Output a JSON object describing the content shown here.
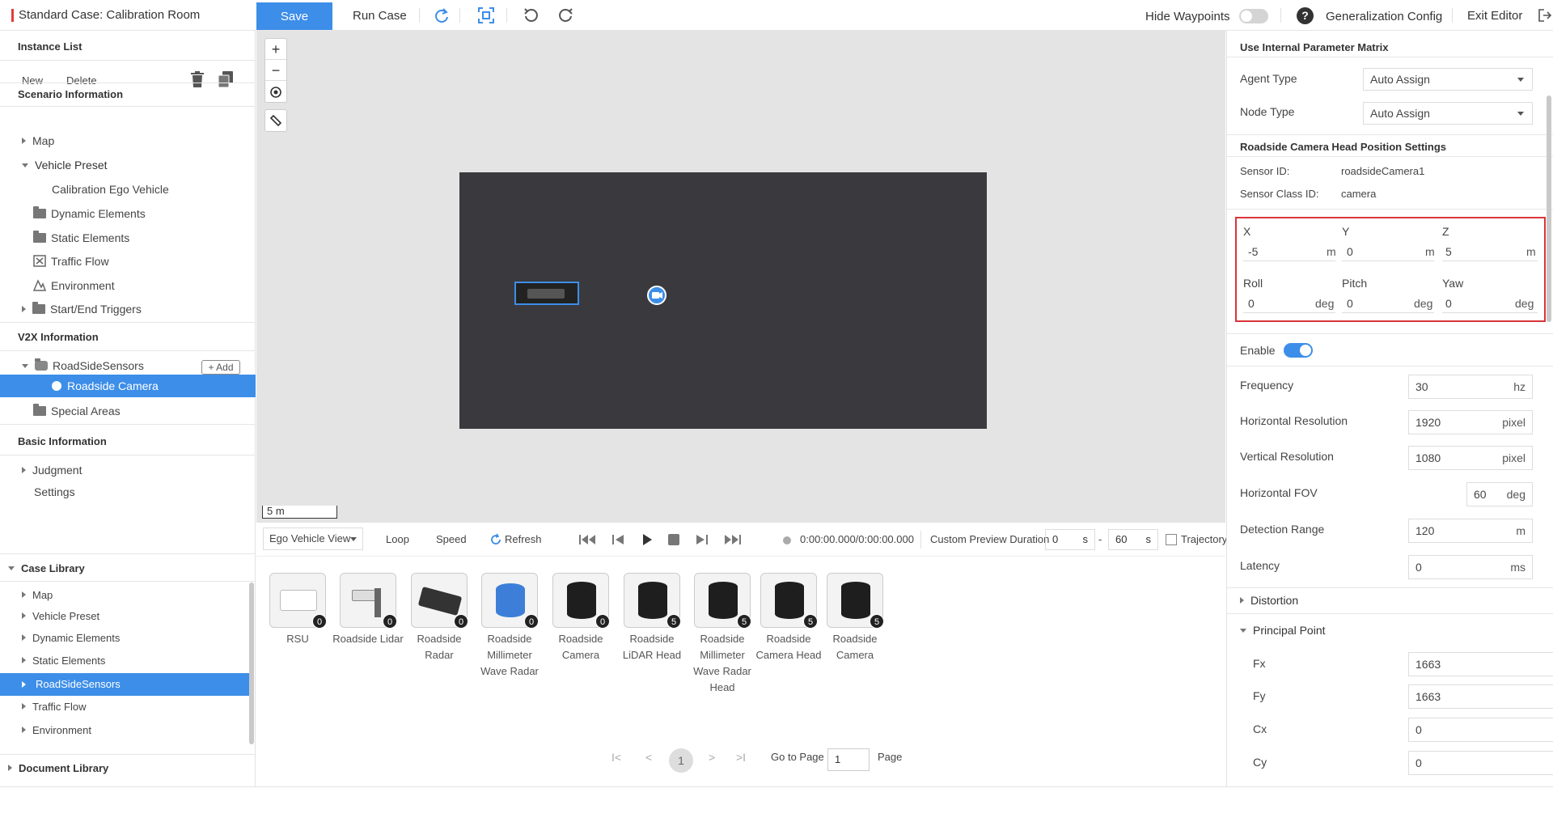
{
  "topbar": {
    "case_title": "Standard Case: Calibration Room",
    "save_label": "Save",
    "run_case_label": "Run Case",
    "hide_waypoints_label": "Hide Waypoints",
    "hide_waypoints_on": false,
    "generalization_config_label": "Generalization Config",
    "exit_editor_label": "Exit Editor",
    "icons": [
      "redo-icon",
      "fit-view-icon",
      "rotate-left-icon",
      "rotate-right-icon",
      "help-icon",
      "exit-icon"
    ]
  },
  "left": {
    "instance_list": "Instance List",
    "new_label": "New",
    "delete_label": "Delete",
    "scenario_information": "Scenario Information",
    "scenario_items": {
      "map": "Map",
      "vehicle_preset": "Vehicle Preset",
      "ego_vehicle": "Calibration Ego Vehicle",
      "dynamic_elements": "Dynamic Elements",
      "static_elements": "Static Elements",
      "traffic_flow": "Traffic Flow",
      "environment": "Environment",
      "start_end_triggers": "Start/End Triggers"
    },
    "v2x_information": "V2X Information",
    "roadside_sensors": "RoadSideSensors",
    "add_label": "+ Add",
    "roadside_camera": "Roadside Camera",
    "special_areas": "Special Areas",
    "basic_information": "Basic Information",
    "judgment": "Judgment",
    "settings": "Settings",
    "case_library": "Case Library",
    "case_library_items": [
      "Map",
      "Vehicle Preset",
      "Dynamic Elements",
      "Static Elements",
      "RoadSideSensors",
      "Traffic Flow",
      "Environment"
    ],
    "case_library_selected": "RoadSideSensors",
    "document_library": "Document Library"
  },
  "canvas": {
    "zoom_in": "+",
    "zoom_out": "−",
    "scale_label": "5 m"
  },
  "playback": {
    "view_select": "Ego Vehicle View",
    "loop_label": "Loop",
    "speed_label": "Speed",
    "refresh_label": "Refresh",
    "time": "0:00:00.000/0:00:00.000",
    "custom_preview_label": "Custom Preview Duration",
    "start_value": "0",
    "start_unit": "s",
    "dash": "-",
    "end_value": "60",
    "end_unit": "s",
    "trajectory_label": "Trajectory"
  },
  "library_tiles": [
    {
      "label": "RSU",
      "count": "0"
    },
    {
      "label": "Roadside Lidar",
      "count": "0"
    },
    {
      "label": "Roadside Radar",
      "count": "0"
    },
    {
      "label": "Roadside Millimeter Wave Radar",
      "count": "0"
    },
    {
      "label": "Roadside Camera",
      "count": "0"
    },
    {
      "label": "Roadside LiDAR Head",
      "count": "5"
    },
    {
      "label": "Roadside Millimeter Wave Radar Head",
      "count": "5"
    },
    {
      "label": "Roadside Camera Head",
      "count": "5"
    },
    {
      "label": "Roadside Camera",
      "count": "5"
    }
  ],
  "pagination": {
    "first": "I<",
    "prev": "<",
    "current": "1",
    "next": ">",
    "last": ">I",
    "goto_label": "Go to Page",
    "goto_value": "1",
    "page_label": "Page"
  },
  "right": {
    "use_internal_matrix": "Use Internal Parameter Matrix",
    "agent_type_label": "Agent Type",
    "agent_type_value": "Auto Assign",
    "node_type_label": "Node Type",
    "node_type_value": "Auto Assign",
    "position_settings": "Roadside Camera Head Position Settings",
    "sensor_id_label": "Sensor ID:",
    "sensor_id_value": "roadsideCamera1",
    "sensor_class_label": "Sensor Class ID:",
    "sensor_class_value": "camera",
    "x_label": "X",
    "x_value": "-5",
    "x_unit": "m",
    "y_label": "Y",
    "y_value": "0",
    "y_unit": "m",
    "z_label": "Z",
    "z_value": "5",
    "z_unit": "m",
    "roll_label": "Roll",
    "roll_value": "0",
    "roll_unit": "deg",
    "pitch_label": "Pitch",
    "pitch_value": "0",
    "pitch_unit": "deg",
    "yaw_label": "Yaw",
    "yaw_value": "0",
    "yaw_unit": "deg",
    "enable_label": "Enable",
    "enable_on": true,
    "frequency_label": "Frequency",
    "frequency_value": "30",
    "frequency_unit": "hz",
    "hres_label": "Horizontal Resolution",
    "hres_value": "1920",
    "hres_unit": "pixel",
    "vres_label": "Vertical Resolution",
    "vres_value": "1080",
    "vres_unit": "pixel",
    "hfov_label": "Horizontal FOV",
    "hfov_value": "60",
    "hfov_unit": "deg",
    "range_label": "Detection Range",
    "range_value": "120",
    "range_unit": "m",
    "latency_label": "Latency",
    "latency_value": "0",
    "latency_unit": "ms",
    "distortion_label": "Distortion",
    "principal_point_label": "Principal Point",
    "fx_label": "Fx",
    "fx_value": "1663",
    "fy_label": "Fy",
    "fy_value": "1663",
    "cx_label": "Cx",
    "cx_value": "0",
    "cy_label": "Cy",
    "cy_value": "0"
  }
}
